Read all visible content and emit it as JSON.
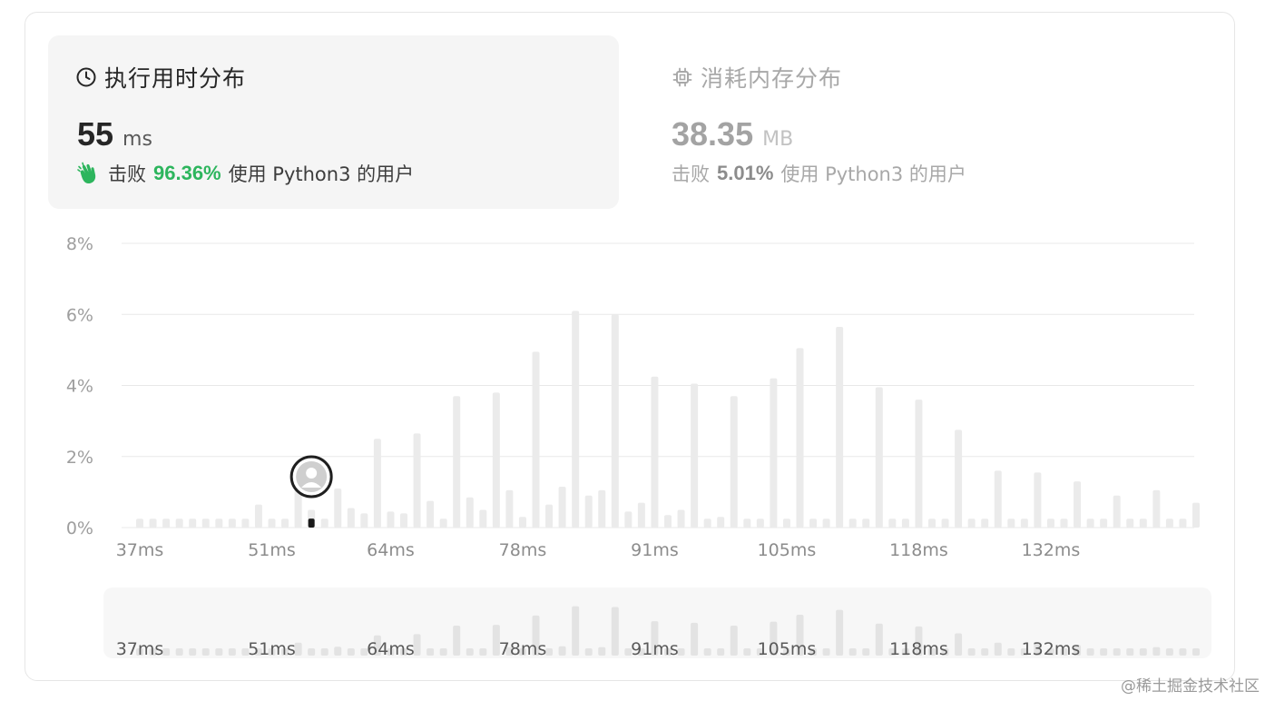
{
  "runtime_panel": {
    "title": "执行用时分布",
    "value": "55",
    "unit": "ms",
    "beats_label": "击败",
    "beats_pct": "96.36%",
    "beats_suffix": "使用 Python3 的用户"
  },
  "memory_panel": {
    "title": "消耗内存分布",
    "value": "38.35",
    "unit": "MB",
    "beats_label": "击败",
    "beats_pct": "5.01%",
    "beats_suffix": "使用 Python3 的用户"
  },
  "watermark": "@稀土掘金技术社区",
  "colors": {
    "bar": "#ebebeb",
    "grid": "#e8e8e8",
    "accent_green": "#2db55d",
    "marker": "#1a1a1a"
  },
  "chart_data": {
    "type": "bar",
    "y_ticks": [
      "0%",
      "2%",
      "4%",
      "6%",
      "8%"
    ],
    "ylim": [
      0,
      8
    ],
    "x_tick_labels": [
      "37ms",
      "51ms",
      "64ms",
      "78ms",
      "91ms",
      "105ms",
      "118ms",
      "132ms"
    ],
    "x_tick_bar_index": [
      0,
      10,
      19,
      29,
      39,
      49,
      59,
      69
    ],
    "values": [
      0.25,
      0.25,
      0.25,
      0.25,
      0.25,
      0.25,
      0.25,
      0.25,
      0.25,
      0.65,
      0.25,
      0.25,
      1.6,
      0.5,
      0.25,
      1.1,
      0.55,
      0.4,
      2.5,
      0.45,
      0.4,
      2.65,
      0.75,
      0.25,
      3.7,
      0.85,
      0.5,
      3.8,
      1.05,
      0.3,
      4.95,
      0.65,
      1.15,
      6.1,
      0.9,
      1.05,
      6.0,
      0.45,
      0.7,
      4.25,
      0.35,
      0.5,
      4.05,
      0.25,
      0.3,
      3.7,
      0.25,
      0.25,
      4.2,
      0.25,
      5.05,
      0.25,
      0.25,
      5.65,
      0.25,
      0.25,
      3.95,
      0.25,
      0.25,
      3.6,
      0.25,
      0.25,
      2.75,
      0.25,
      0.25,
      1.6,
      0.25,
      0.25,
      1.55,
      0.25,
      0.25,
      1.3,
      0.25,
      0.25,
      0.9,
      0.25,
      0.25,
      1.05,
      0.25,
      0.25,
      0.7
    ],
    "current_bar_index": 13,
    "current_value": 0.2
  }
}
